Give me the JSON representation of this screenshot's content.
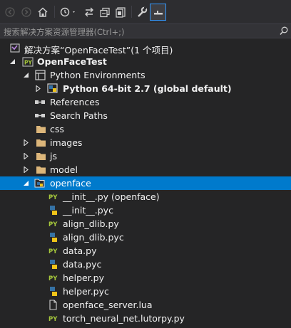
{
  "toolbar": {
    "buttons": [
      "back-icon",
      "forward-icon",
      "home-icon",
      "history-icon",
      "sync-icon",
      "collapse-all-icon",
      "show-all-files-icon",
      "properties-icon",
      "preview-icon"
    ]
  },
  "search": {
    "placeholder": "搜索解决方案资源管理器(Ctrl+;)"
  },
  "tree": {
    "solution": "解决方案“OpenFaceTest”(1 个项目)",
    "project": "OpenFaceTest",
    "python_environments": "Python Environments",
    "python_env": "Python 64-bit 2.7 (global default)",
    "references": "References",
    "search_paths": "Search Paths",
    "folders": [
      "css",
      "images",
      "js",
      "model"
    ],
    "openface": "openface",
    "files": [
      "__init__.py (openface)",
      "__init__.pyc",
      "align_dlib.py",
      "align_dlib.pyc",
      "data.py",
      "data.pyc",
      "helper.py",
      "helper.pyc",
      "openface_server.lua",
      "torch_neural_net.lutorpy.py"
    ]
  },
  "colors": {
    "background": "#252526",
    "selection": "#007acc",
    "folder": "#dcb67a",
    "python_green": "#a6c83c"
  }
}
